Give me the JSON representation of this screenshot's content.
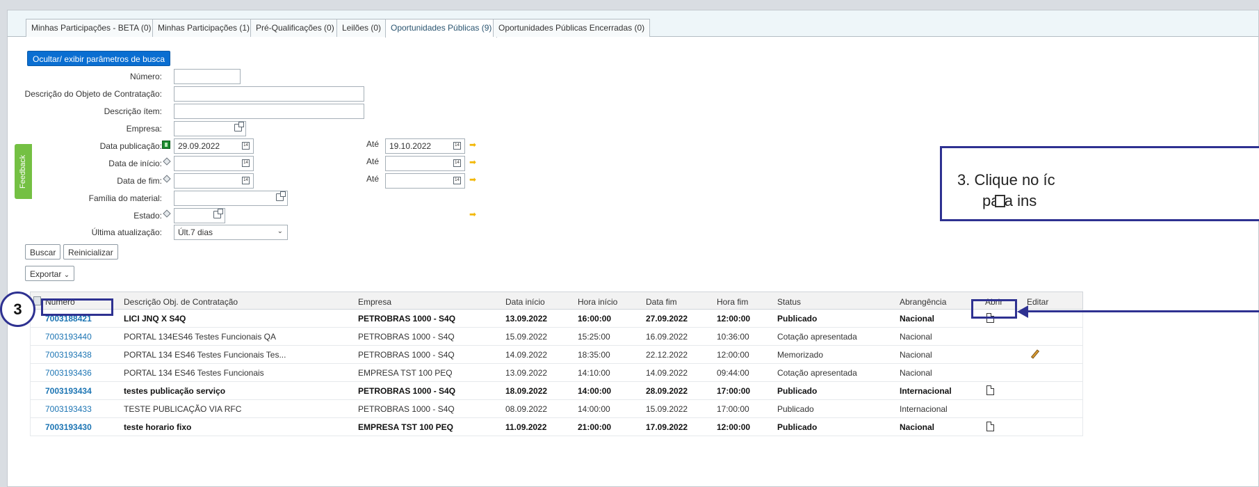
{
  "tabs": [
    {
      "label": "Minhas Participações - BETA (0)"
    },
    {
      "label": "Minhas Participações (1)"
    },
    {
      "label": "Pré-Qualificações (0)"
    },
    {
      "label": "Leilões (0)"
    },
    {
      "label": "Oportunidades Públicas (9)"
    },
    {
      "label": "Oportunidades Públicas Encerradas (0)"
    }
  ],
  "toggle_search_label": "Ocultar/ exibir parâmetros de busca",
  "search": {
    "numero_label": "Número:",
    "descricao_objeto_label": "Descrição do Objeto de Contratação:",
    "descricao_item_label": "Descrição ítem:",
    "empresa_label": "Empresa:",
    "data_publicacao_label": "Data publicação:",
    "data_publicacao_de": "29.09.2022",
    "data_publicacao_ate": "19.10.2022",
    "data_inicio_label": "Data de início:",
    "data_fim_label": "Data de fim:",
    "ate_label": "Até",
    "familia_label": "Família do material:",
    "estado_label": "Estado:",
    "ultima_atualizacao_label": "Última atualização:",
    "ultima_atualizacao_value": "Últ.7 dias",
    "cal_glyph": "14"
  },
  "buttons": {
    "buscar": "Buscar",
    "reinicializar": "Reinicializar",
    "exportar": "Exportar"
  },
  "feedback_label": "Feedback",
  "table": {
    "headers": [
      "Número",
      "Descrição Obj. de Contratação",
      "Empresa",
      "Data início",
      "Hora início",
      "Data fim",
      "Hora fim",
      "Status",
      "Abrangência",
      "Abrir",
      "Editar"
    ],
    "rows": [
      {
        "numero": "7003188421",
        "descricao": "LICI JNQ X S4Q",
        "empresa": "PETROBRAS 1000 - S4Q",
        "data_inicio": "13.09.2022",
        "hora_inicio": "16:00:00",
        "data_fim": "27.09.2022",
        "hora_fim": "12:00:00",
        "status": "Publicado",
        "abrangencia": "Nacional"
      },
      {
        "numero": "7003193440",
        "descricao": "PORTAL 134ES46  Testes Funcionais QA",
        "empresa": "PETROBRAS 1000 - S4Q",
        "data_inicio": "15.09.2022",
        "hora_inicio": "15:25:00",
        "data_fim": "16.09.2022",
        "hora_fim": "10:36:00",
        "status": "Cotação apresentada",
        "abrangencia": "Nacional"
      },
      {
        "numero": "7003193438",
        "descricao": "PORTAL 134 ES46 Testes Funcionais Tes...",
        "empresa": "PETROBRAS 1000 - S4Q",
        "data_inicio": "14.09.2022",
        "hora_inicio": "18:35:00",
        "data_fim": "22.12.2022",
        "hora_fim": "12:00:00",
        "status": "Memorizado",
        "abrangencia": "Nacional"
      },
      {
        "numero": "7003193436",
        "descricao": "PORTAL 134 ES46 Testes Funcionais",
        "empresa": "EMPRESA TST 100 PEQ",
        "data_inicio": "13.09.2022",
        "hora_inicio": "14:10:00",
        "data_fim": "14.09.2022",
        "hora_fim": "09:44:00",
        "status": "Cotação apresentada",
        "abrangencia": "Nacional"
      },
      {
        "numero": "7003193434",
        "descricao": "testes publicação serviço",
        "empresa": "PETROBRAS 1000 - S4Q",
        "data_inicio": "18.09.2022",
        "hora_inicio": "14:00:00",
        "data_fim": "28.09.2022",
        "hora_fim": "17:00:00",
        "status": "Publicado",
        "abrangencia": "Internacional"
      },
      {
        "numero": "7003193433",
        "descricao": "TESTE PUBLICAÇÃO VIA RFC",
        "empresa": "PETROBRAS 1000 - S4Q",
        "data_inicio": "08.09.2022",
        "hora_inicio": "14:00:00",
        "data_fim": "15.09.2022",
        "hora_fim": "17:00:00",
        "status": "Publicado",
        "abrangencia": "Internacional"
      },
      {
        "numero": "7003193430",
        "descricao": "teste horario fixo",
        "empresa": "EMPRESA TST 100 PEQ",
        "data_inicio": "11.09.2022",
        "hora_inicio": "21:00:00",
        "data_fim": "17.09.2022",
        "hora_fim": "12:00:00",
        "status": "Publicado",
        "abrangencia": "Nacional"
      }
    ]
  },
  "callout": {
    "line1": "3. Clique no íc",
    "line2": "para ins"
  },
  "step_number": "3",
  "icons": {
    "open": "document-icon",
    "edit": "pencil-icon",
    "help": "value-help-icon",
    "calendar": "calendar-icon",
    "arrow": "arrow-right-icon"
  },
  "colors": {
    "primary_button": "#0a6ed1",
    "link": "#1b74b3",
    "annotation": "#2e3191",
    "feedback": "#74c043"
  }
}
